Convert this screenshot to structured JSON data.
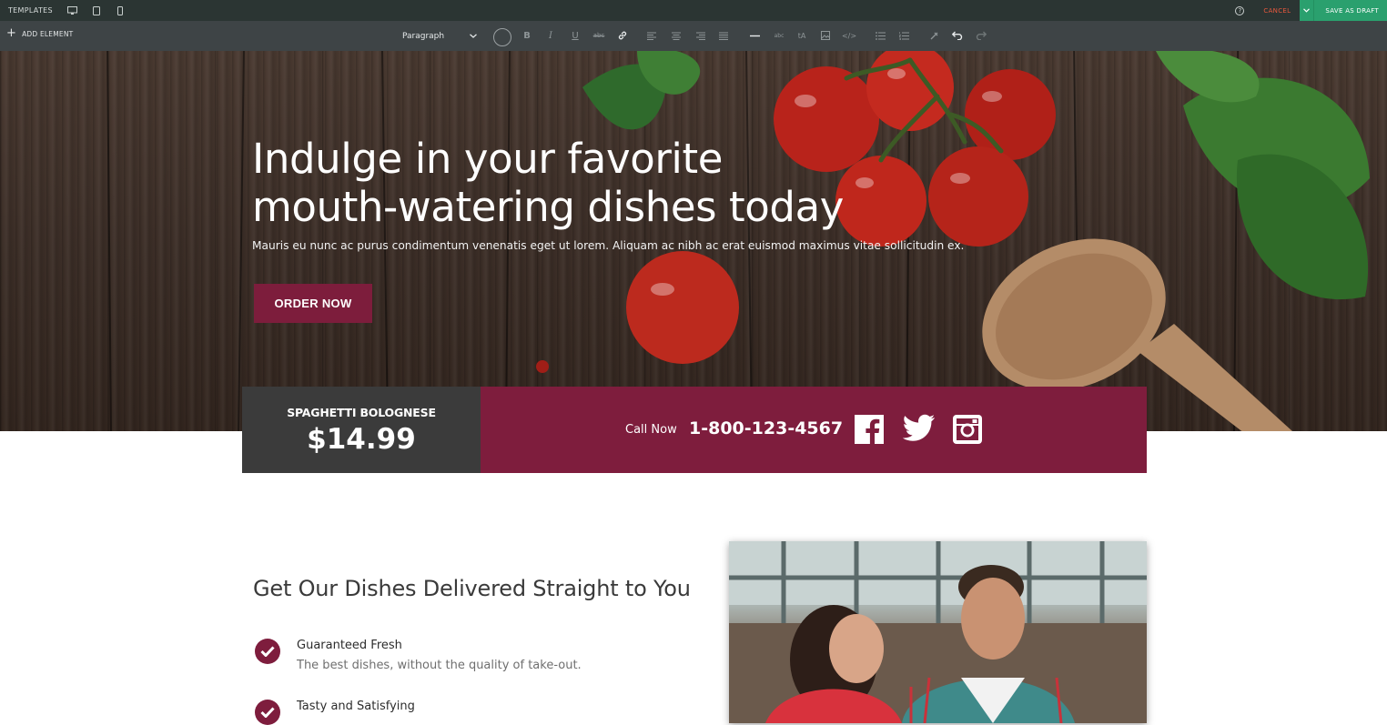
{
  "topbar": {
    "templates_label": "TEMPLATES",
    "device_icons": [
      "desktop-icon",
      "tablet-icon",
      "mobile-icon"
    ],
    "cancel_label": "CANCEL",
    "save_label": "SAVE AS DRAFT"
  },
  "toolbar": {
    "add_element_label": "ADD ELEMENT",
    "format_select": "Paragraph",
    "format_icons": [
      "color-picker-icon",
      "bold-icon",
      "italic-icon",
      "underline-icon",
      "strikethrough-icon",
      "link-icon",
      "align-left-icon",
      "align-center-icon",
      "align-right-icon",
      "align-justify-icon",
      "horizontal-rule-icon",
      "remove-format-icon",
      "font-size-icon",
      "image-icon",
      "code-icon",
      "bulleted-list-icon",
      "numbered-list-icon",
      "clear-icon",
      "undo-icon",
      "redo-icon"
    ]
  },
  "hero": {
    "title_line1": "Indulge in your favorite",
    "title_line2": "mouth-watering dishes today",
    "subtitle": "Mauris eu nunc ac purus condimentum venenatis eget ut lorem. Aliquam ac nibh ac erat euismod maximus vitae sollicitudin ex.",
    "cta_label": "ORDER NOW"
  },
  "promo": {
    "dish_name": "SPAGHETTI BOLOGNESE",
    "price": "$14.99",
    "call_label": "Call Now",
    "phone": "1-800-123-4567",
    "social_icons": [
      "facebook-icon",
      "twitter-icon",
      "instagram-icon"
    ]
  },
  "delivery": {
    "title": "Get Our Dishes Delivered Straight to You",
    "features": [
      {
        "title": "Guaranteed Fresh",
        "description": "The best dishes, without the quality of take-out."
      },
      {
        "title": "Tasty and Satisfying",
        "description": ""
      }
    ]
  },
  "colors": {
    "brand": "#7e1d3d",
    "save_green": "#2aa06e",
    "cancel_red": "#e8583d",
    "price_box": "#3b3b3b"
  }
}
